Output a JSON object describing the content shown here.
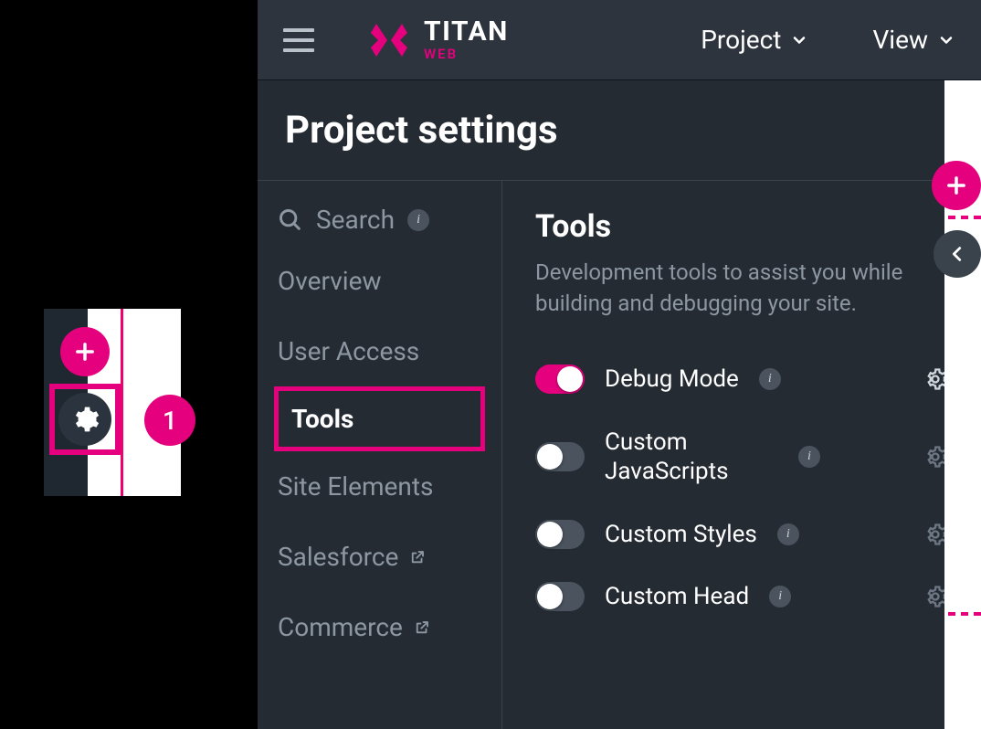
{
  "brand": {
    "title": "TITAN",
    "subtitle": "WEB"
  },
  "top_menu": {
    "project": "Project",
    "view": "View"
  },
  "page": {
    "title": "Project settings"
  },
  "sidebar": {
    "search_placeholder": "Search",
    "items": [
      {
        "label": "Overview"
      },
      {
        "label": "User Access"
      },
      {
        "label": "Tools"
      },
      {
        "label": "Site Elements"
      },
      {
        "label": "Salesforce"
      },
      {
        "label": "Commerce"
      }
    ]
  },
  "detail": {
    "title": "Tools",
    "desc": "Development tools to assist you while building and debugging your site.",
    "tools": [
      {
        "label": "Debug Mode",
        "on": true,
        "gear_bright": true,
        "info": true
      },
      {
        "label": "Custom JavaScripts",
        "on": false,
        "gear_bright": false,
        "info": true
      },
      {
        "label": "Custom Styles",
        "on": false,
        "gear_bright": false,
        "info": true
      },
      {
        "label": "Custom Head",
        "on": false,
        "gear_bright": false,
        "info": true
      }
    ]
  },
  "thumb": {
    "badge": "1"
  },
  "glyph": {
    "info": "i"
  }
}
